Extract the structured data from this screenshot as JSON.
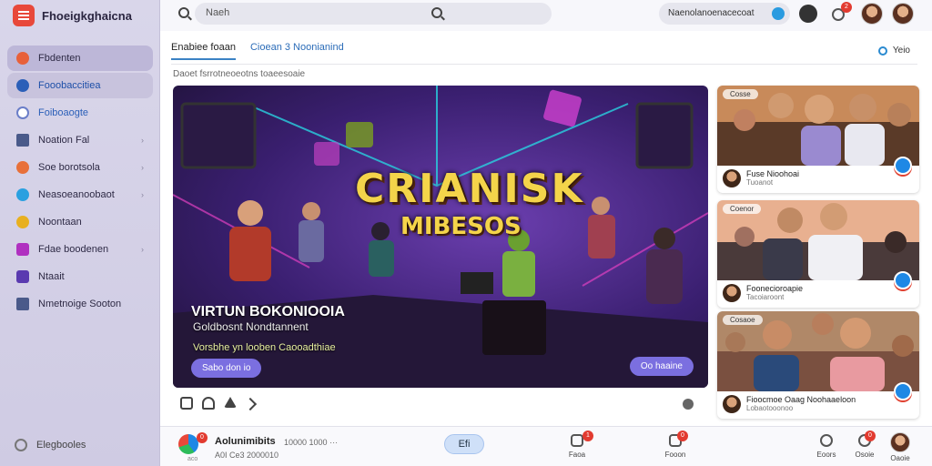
{
  "app": {
    "name": "Fhoeigkghaicna"
  },
  "sidebar": {
    "items": [
      {
        "label": "Fbdenten",
        "icon": "home-icon",
        "color": "#e8603a",
        "state": "active",
        "chevron": false
      },
      {
        "label": "Fooobaccitiea",
        "icon": "music-icon",
        "color": "#2b5fb8",
        "state": "highlight",
        "chevron": false
      },
      {
        "label": "Foiboaogte",
        "icon": "playlist-icon",
        "color": "#6a7ec8",
        "state": "link",
        "chevron": false
      },
      {
        "label": "Noation Fal",
        "icon": "grid-icon",
        "color": "#4a5a8a",
        "state": "normal",
        "chevron": true
      },
      {
        "label": "Soe borotsola",
        "icon": "radio-icon",
        "color": "#e8703a",
        "state": "normal",
        "chevron": true,
        "badge_color": "#2a8ad0"
      },
      {
        "label": "Neasoeanoobaot",
        "icon": "community-icon",
        "color": "#2aa0e0",
        "state": "normal",
        "chevron": true,
        "badge_color": "#f08020"
      },
      {
        "label": "Noontaan",
        "icon": "star-icon",
        "color": "#e8b020",
        "state": "normal",
        "chevron": false
      },
      {
        "label": "Fdae boodenen",
        "icon": "video-icon",
        "color": "#b030c0",
        "state": "normal",
        "chevron": true,
        "badge_color": "#f08020"
      },
      {
        "label": "Ntaait",
        "icon": "chart-icon",
        "color": "#5a3ab0",
        "state": "normal",
        "chevron": false
      },
      {
        "label": "Nmetnoige Sooton",
        "icon": "calendar-icon",
        "color": "#4a5a8a",
        "state": "normal",
        "chevron": false,
        "badge_color": "#2a8ad0"
      }
    ],
    "footer_label": "Elegbooles"
  },
  "topbar": {
    "search_placeholder": "Naeh",
    "context_text": "Naenolanoenacecoat",
    "notification_count": "2"
  },
  "main": {
    "tabs": [
      {
        "label": "Enabiee foaan",
        "active": true
      },
      {
        "label": "Cioean 3 Noonianind",
        "active": false
      }
    ],
    "view_label": "Yeio",
    "section_label": "Daoet fsrrotneoeotns toaeesoaie"
  },
  "hero": {
    "title": "CRIANISK",
    "subtitle": "MIBESOS",
    "heading": "VIRTUN BOKONIOOIA",
    "description": "Goldbosnt Nondtannent",
    "caption": "Vorsbhe yn looben Caooadthiae",
    "button_left": "Sabo don io",
    "button_right": "Oo haaine"
  },
  "cards": [
    {
      "tag": "Cosse",
      "title": "Fuse Nioohoai",
      "subtitle": "Tuoanot"
    },
    {
      "tag": "Coenor",
      "title": "Foonecioroapie",
      "subtitle": "Tacoiaroont"
    },
    {
      "tag": "Cosaoe",
      "title": "Fioocmoe Oaag Noohaaeloon",
      "subtitle": "Lobaotooonoo"
    }
  ],
  "bottombar": {
    "user_name": "Aolunimibits",
    "user_meta": "10000 1000",
    "user_more": "···",
    "user_sub": "A0I Ce3 2000010",
    "user_sub2": "aco",
    "avatar_badge": "0",
    "pill_label": "Efi",
    "items": [
      {
        "label": "Faoa",
        "badge": "1"
      },
      {
        "label": "Fooon",
        "badge": "0"
      },
      {
        "label": "Eoors",
        "badge": ""
      },
      {
        "label": "Osoie",
        "badge": "0"
      }
    ]
  },
  "colors": {
    "accent": "#3b82c4",
    "hero_title": "#f4d44a",
    "button": "#7b6fe0",
    "badge": "#e23b30"
  }
}
